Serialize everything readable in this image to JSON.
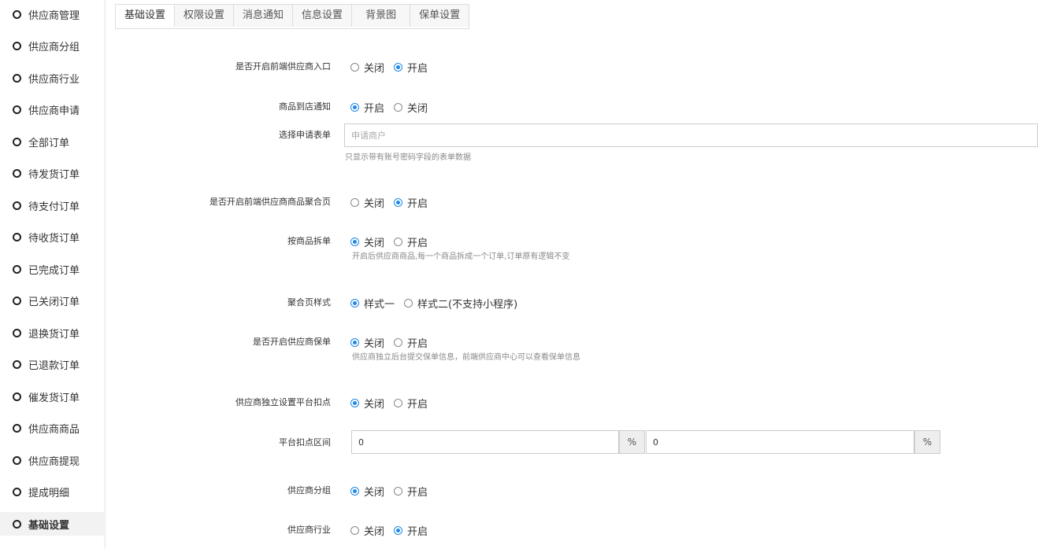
{
  "sidebar": {
    "items": [
      {
        "label": "供应商管理"
      },
      {
        "label": "供应商分组"
      },
      {
        "label": "供应商行业"
      },
      {
        "label": "供应商申请"
      },
      {
        "label": "全部订单"
      },
      {
        "label": "待发货订单"
      },
      {
        "label": "待支付订单"
      },
      {
        "label": "待收货订单"
      },
      {
        "label": "已完成订单"
      },
      {
        "label": "已关闭订单"
      },
      {
        "label": "退换货订单"
      },
      {
        "label": "已退款订单"
      },
      {
        "label": "催发货订单"
      },
      {
        "label": "供应商商品"
      },
      {
        "label": "供应商提现"
      },
      {
        "label": "提成明细"
      },
      {
        "label": "基础设置"
      }
    ]
  },
  "tabs": [
    "基础设置",
    "权限设置",
    "消息通知",
    "信息设置",
    "背景图",
    "保单设置"
  ],
  "settings": {
    "entry": {
      "label": "是否开启前端供应商入口",
      "opt1": "关闭",
      "opt2": "开启"
    },
    "arrival": {
      "label": "商品到店通知",
      "opt1": "开启",
      "opt2": "关闭"
    },
    "form": {
      "label": "选择申请表单",
      "placeholder": "申请商户",
      "help": "只显示带有账号密码字段的表单数据"
    },
    "aggregate": {
      "label": "是否开启前端供应商商品聚合页",
      "opt1": "关闭",
      "opt2": "开启"
    },
    "split": {
      "label": "按商品拆单",
      "opt1": "关闭",
      "opt2": "开启",
      "help": "开启后供应商商品,每一个商品拆成一个订单,订单原有逻辑不变"
    },
    "style": {
      "label": "聚合页样式",
      "opt1": "样式一",
      "opt2": "样式二(不支持小程序)"
    },
    "policy": {
      "label": "是否开启供应商保单",
      "opt1": "关闭",
      "opt2": "开启",
      "help": "供应商独立后台提交保单信息，前端供应商中心可以查看保单信息"
    },
    "deduct": {
      "label": "供应商独立设置平台扣点",
      "opt1": "关闭",
      "opt2": "开启"
    },
    "range": {
      "label": "平台扣点区间",
      "min": "0",
      "max": "0",
      "unit": "%"
    },
    "group": {
      "label": "供应商分组",
      "opt1": "关闭",
      "opt2": "开启"
    },
    "industry": {
      "label": "供应商行业",
      "opt1": "关闭",
      "opt2": "开启"
    }
  }
}
